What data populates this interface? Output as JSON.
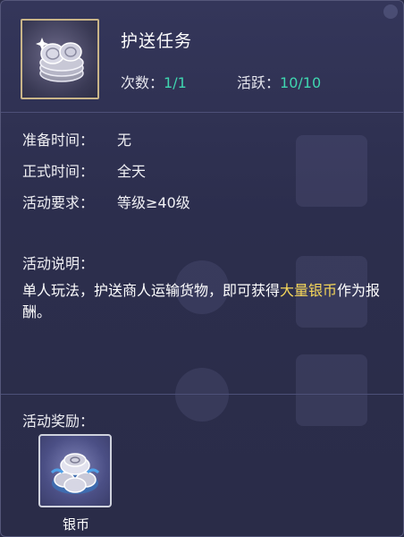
{
  "task": {
    "title": "护送任务",
    "icon": "silver-coins-icon",
    "count_label": "次数：",
    "count_value": "1/1",
    "active_label": "活跃：",
    "active_value": "10/10"
  },
  "info": {
    "prep_label": "准备时间：",
    "prep_value": "无",
    "time_label": "正式时间：",
    "time_value": "全天",
    "req_label": "活动要求：",
    "req_value": "等级≥40级"
  },
  "description": {
    "label": "活动说明：",
    "text_before": "单人玩法，护送商人运输货物，即可获得",
    "highlight": "大量银币",
    "text_after": "作为报酬。"
  },
  "rewards": {
    "label": "活动奖励：",
    "items": [
      {
        "name": "银币",
        "icon": "silver-coin-pile-icon"
      }
    ]
  },
  "colors": {
    "value_green": "#3fd6b0",
    "highlight_yellow": "#f5d65a",
    "icon_border_gold": "#c9b588"
  }
}
